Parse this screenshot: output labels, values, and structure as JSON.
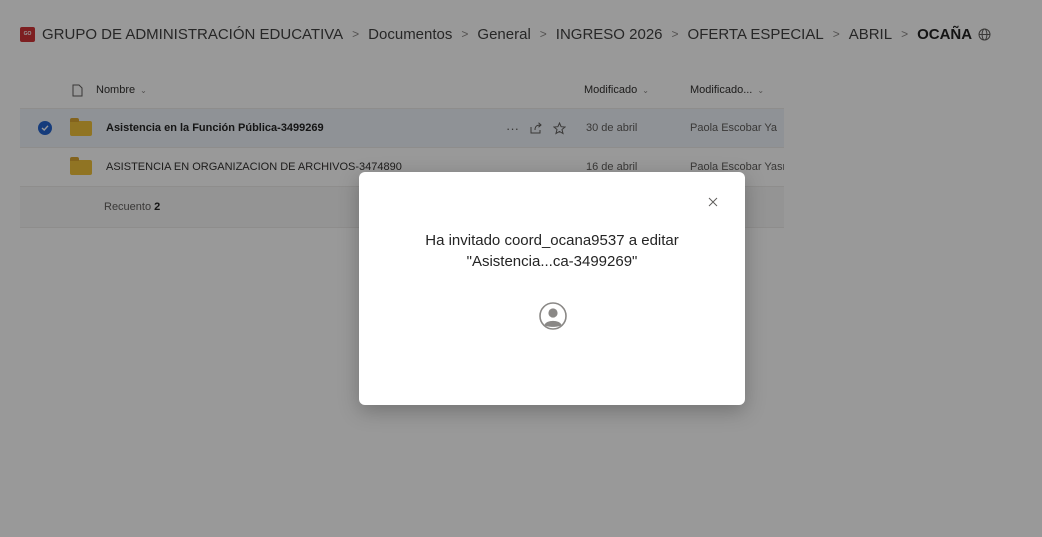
{
  "breadcrumb": {
    "logo_text": "GO",
    "items": [
      "GRUPO DE ADMINISTRACIÓN EDUCATIVA",
      "Documentos",
      "General",
      "INGRESO 2026",
      "OFERTA ESPECIAL",
      "ABRIL"
    ],
    "current": "OCAÑA",
    "separator": ">"
  },
  "list": {
    "columns": {
      "name": "Nombre",
      "modified": "Modificado",
      "modified_by": "Modificado..."
    },
    "rows": [
      {
        "name": "Asistencia en la Función Pública-3499269",
        "modified": "30 de abril",
        "modified_by": "Paola Escobar Ya",
        "selected": true
      },
      {
        "name": "ASISTENCIA EN ORGANIZACION DE ARCHIVOS-3474890",
        "modified": "16 de abril",
        "modified_by": "Paola Escobar Yasn",
        "selected": false
      }
    ],
    "count_label": "Recuento",
    "count_value": "2",
    "row_actions": {
      "more": "···"
    }
  },
  "dialog": {
    "message_line1": "Ha invitado coord_ocana9537 a editar",
    "message_line2": "\"Asistencia...ca-3499269\""
  },
  "colors": {
    "accent": "#2564cf",
    "folder": "#f0c23b",
    "logo": "#d13438"
  }
}
